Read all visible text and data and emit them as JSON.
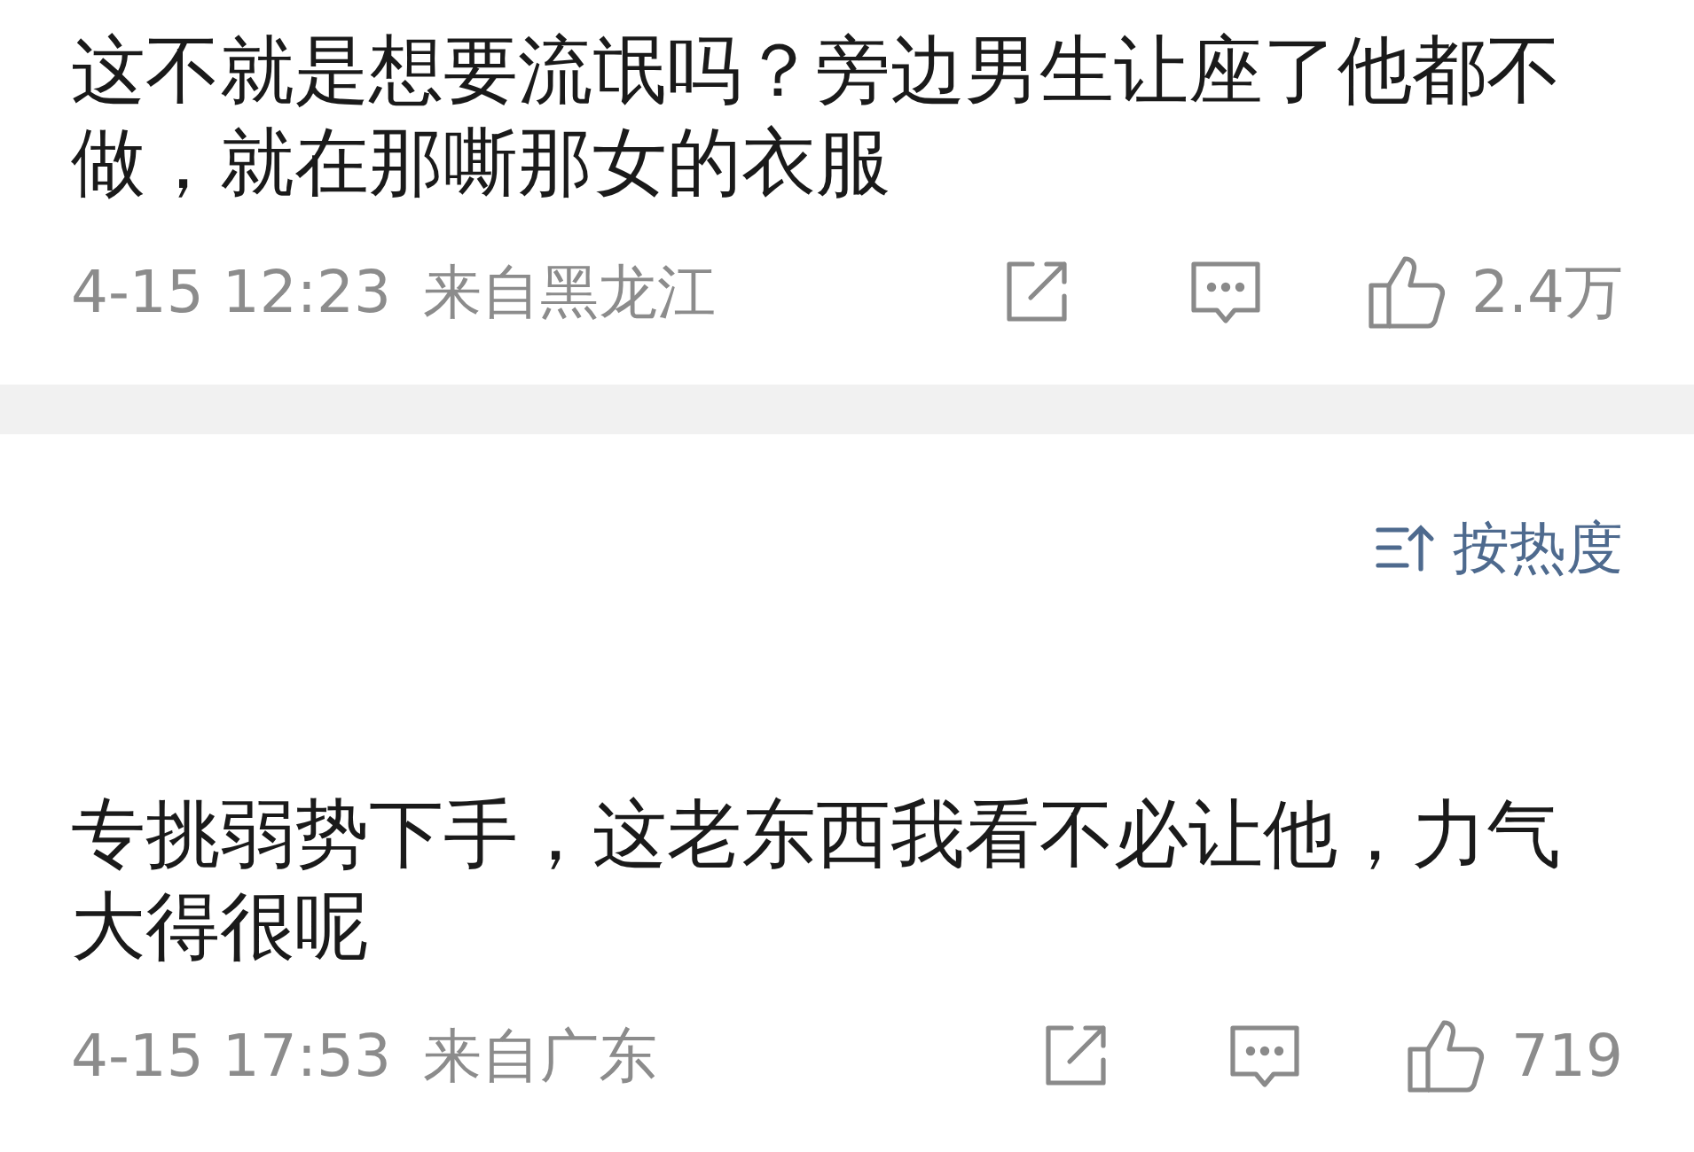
{
  "comments": [
    {
      "lines": [
        "这不就是想要流氓吗？旁边男生让座了他都不",
        "做，就在那嘶那女的衣服"
      ],
      "date": "4-15 12:23",
      "location": "来自黑龙江",
      "likes": "2.4万"
    },
    {
      "lines": [
        "专挑弱势下手，这老东西我看不必让他，力气",
        "大得很呢"
      ],
      "date": "4-15 17:53",
      "location": "来自广东",
      "likes": "719"
    }
  ],
  "sort": {
    "label": "按热度"
  }
}
